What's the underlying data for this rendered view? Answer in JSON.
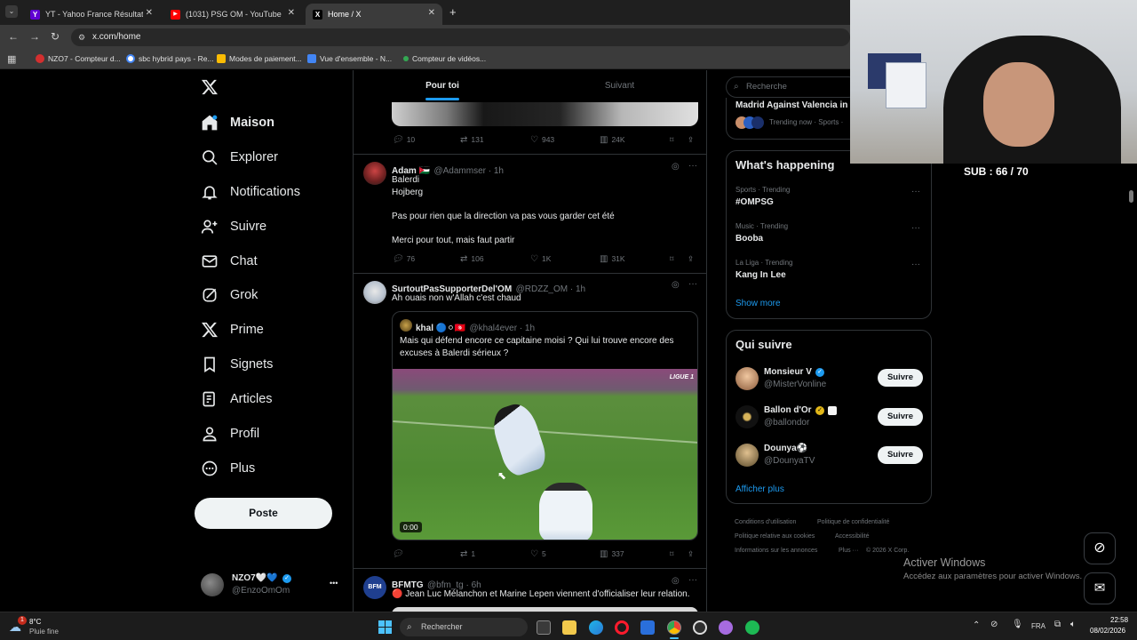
{
  "browser": {
    "tabs": [
      {
        "title": "YT - Yahoo France Résultats de",
        "icon": "yahoo-icon",
        "color": "#6001d2",
        "glyph": "Y!"
      },
      {
        "title": "(1031) PSG OM - YouTube",
        "icon": "youtube-icon",
        "color": "#ff0000",
        "glyph": "▶"
      },
      {
        "title": "Home / X",
        "icon": "x-logo-icon",
        "color": "#000000",
        "glyph": "𝕏"
      }
    ],
    "new_tab": "+",
    "url": "x.com/home",
    "bookmarks": [
      {
        "label": "NZO7 - Compteur d...",
        "color": "#d32f2f"
      },
      {
        "label": "sbc hybrid pays - Re...",
        "color": "#4285f4"
      },
      {
        "label": "Modes de paiement...",
        "color": "#fbbc04"
      },
      {
        "label": "Vue d'ensemble - N...",
        "color": "#4285f4"
      },
      {
        "label": "Compteur de vidéos...",
        "color": "#34a853"
      }
    ]
  },
  "nav": {
    "items": [
      {
        "label": "Maison",
        "icon": "home-icon"
      },
      {
        "label": "Explorer",
        "icon": "search-icon"
      },
      {
        "label": "Notifications",
        "icon": "bell-icon"
      },
      {
        "label": "Suivre",
        "icon": "person-add-icon"
      },
      {
        "label": "Chat",
        "icon": "mail-icon"
      },
      {
        "label": "Grok",
        "icon": "grok-icon"
      },
      {
        "label": "Prime",
        "icon": "x-icon"
      },
      {
        "label": "Signets",
        "icon": "bookmark-icon"
      },
      {
        "label": "Articles",
        "icon": "article-icon"
      },
      {
        "label": "Profil",
        "icon": "profile-icon"
      },
      {
        "label": "Plus",
        "icon": "more-icon"
      }
    ],
    "post_button": "Poste",
    "account": {
      "name": "NZO7🤍💙",
      "handle": "@EnzoOmOm",
      "more": "•••"
    }
  },
  "timeline": {
    "tabs": [
      "Pour toi",
      "Suivant"
    ],
    "top_actions": {
      "replies": "10",
      "reposts": "131",
      "likes": "943",
      "views": "24K"
    },
    "tweets": [
      {
        "name": "Adam 🇯🇴",
        "handle": "@Adammser · 1h",
        "lines": [
          "Balerdi",
          "Hojberg",
          "",
          "Pas pour rien que la direction va pas vous garder cet été",
          "",
          "Merci pour tout, mais faut partir"
        ],
        "replies": "76",
        "reposts": "106",
        "likes": "1K",
        "views": "31K"
      },
      {
        "name": "SurtoutPasSupporterDel'OM",
        "handle": "@RDZZ_OM · 1h",
        "text": "Ah ouais non w'Allah c'est chaud",
        "quote": {
          "name": "khal 🔵⚪🇹🇳",
          "handle": "@khal4ever · 1h",
          "text": "Mais qui défend encore ce capitaine moisi ? Qui lui trouve encore des excuses à Balerdi sérieux ?",
          "video_time": "0:00",
          "video_logo": "LIGUE 1"
        },
        "replies": "",
        "reposts": "1",
        "likes": "5",
        "views": "337"
      },
      {
        "name": "BFMTG",
        "handle": "@bfm_tg · 6h",
        "text": "🔴 Jean Luc Mélanchon et Marine Lepen viennent d'officialiser leur relation."
      }
    ]
  },
  "sidebar": {
    "search_placeholder": "Recherche",
    "trending_now": {
      "title": "Madrid Against Valencia in",
      "meta": "Trending now · Sports ·"
    },
    "happening": {
      "title": "What's happening",
      "items": [
        {
          "meta": "Sports · Trending",
          "topic": "#OMPSG"
        },
        {
          "meta": "Music · Trending",
          "topic": "Booba"
        },
        {
          "meta": "La Liga · Trending",
          "topic": "Kang In Lee"
        }
      ],
      "show_more": "Show more"
    },
    "who_to_follow": {
      "title": "Qui suivre",
      "accounts": [
        {
          "name": "Monsieur V",
          "handle": "@MisterVonline",
          "button": "Suivre"
        },
        {
          "name": "Ballon d'Or",
          "handle": "@ballondor",
          "button": "Suivre"
        },
        {
          "name": "Dounya⚽",
          "handle": "@DounyaTV",
          "button": "Suivre"
        }
      ],
      "more": "Afficher plus"
    },
    "footer": [
      "Conditions d'utilisation",
      "Politique de confidentialité",
      "Politique relative aux cookies",
      "Accessibilité",
      "Informations sur les annonces",
      "Plus ···",
      "© 2026 X Corp."
    ]
  },
  "overlay": {
    "sub_counter": "SUB : 66 / 70",
    "activate_title": "Activer Windows",
    "activate_sub": "Accédez aux paramètres pour activer Windows."
  },
  "taskbar": {
    "weather_temp": "8°C",
    "weather_desc": "Pluie fine",
    "search": "Rechercher",
    "lang": "FRA",
    "time": "22:58",
    "date": "08/02/2026"
  },
  "colors": {
    "accent": "#1d9bf0",
    "bg": "#000000",
    "border": "#2f3336",
    "muted": "#71767b"
  }
}
